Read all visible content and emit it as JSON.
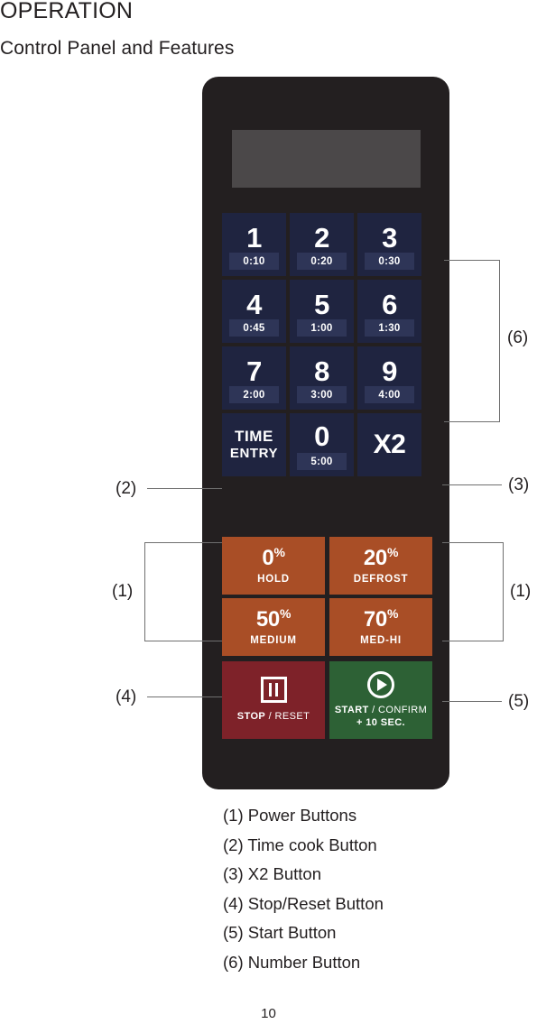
{
  "headings": {
    "title": "OPERATION",
    "subtitle": "Control Panel and Features"
  },
  "panel": {
    "display_label": "",
    "keypad": [
      [
        {
          "digit": "1",
          "time": "0:10"
        },
        {
          "digit": "2",
          "time": "0:20"
        },
        {
          "digit": "3",
          "time": "0:30"
        }
      ],
      [
        {
          "digit": "4",
          "time": "0:45"
        },
        {
          "digit": "5",
          "time": "1:00"
        },
        {
          "digit": "6",
          "time": "1:30"
        }
      ],
      [
        {
          "digit": "7",
          "time": "2:00"
        },
        {
          "digit": "8",
          "time": "3:00"
        },
        {
          "digit": "9",
          "time": "4:00"
        }
      ]
    ],
    "bottom_row": {
      "time_entry_line1": "TIME",
      "time_entry_line2": "ENTRY",
      "zero_digit": "0",
      "zero_time": "5:00",
      "x2_label": "X2"
    },
    "power_buttons": [
      [
        {
          "percent": "0",
          "symbol": "%",
          "sub": "HOLD"
        },
        {
          "percent": "20",
          "symbol": "%",
          "sub": "DEFROST"
        }
      ],
      [
        {
          "percent": "50",
          "symbol": "%",
          "sub": "MEDIUM"
        },
        {
          "percent": "70",
          "symbol": "%",
          "sub": "MED-HI"
        }
      ]
    ],
    "stop_button": {
      "label_bold": "STOP",
      "label_sep": " / ",
      "label_light": "RESET"
    },
    "start_button": {
      "label_bold": "START",
      "label_sep": " / ",
      "label_light": "CONFIRM",
      "label_line2": "+ 10 SEC."
    }
  },
  "callouts": {
    "c1_left": "(1)",
    "c1_right": "(1)",
    "c2": "(2)",
    "c3": "(3)",
    "c4": "(4)",
    "c5": "(5)",
    "c6": "(6)"
  },
  "legend": [
    "(1) Power Buttons",
    "(2) Time cook Button",
    "(3) X2 Button",
    "(4) Stop/Reset Button",
    "(5) Start Button",
    "(6) Number Button"
  ],
  "page_number": "10",
  "colors": {
    "panel_body": "#231f20",
    "display": "#4b4849",
    "number_key": "#1f2440",
    "number_key_badge": "#2e3557",
    "power_key": "#a94e26",
    "stop_key": "#7e2229",
    "start_key": "#2d6135",
    "text_on_key": "#ffffff",
    "leader_line": "#6f6f6f"
  }
}
